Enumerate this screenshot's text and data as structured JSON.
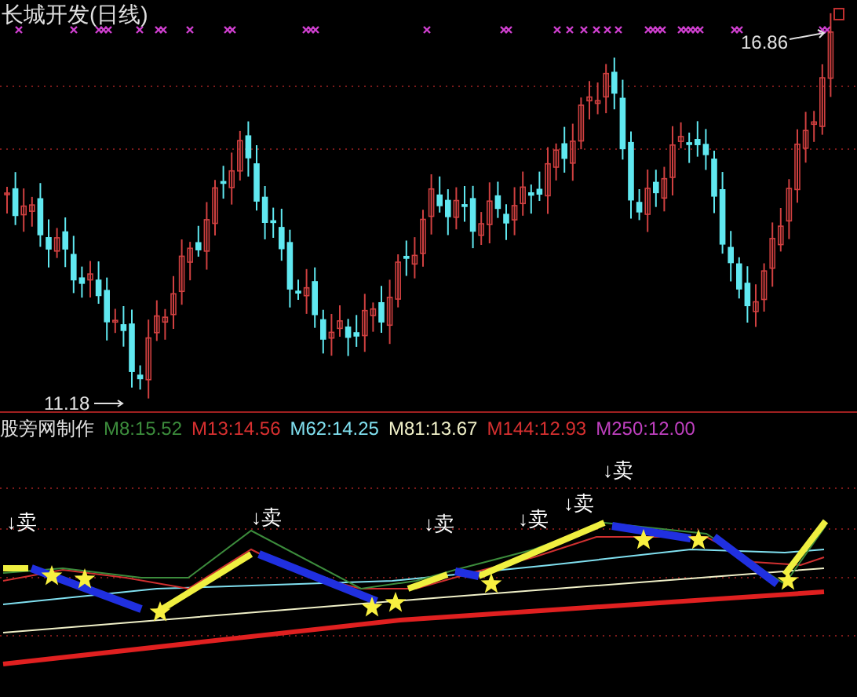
{
  "price_panel": {
    "title": "长城开发(日线)",
    "high_label": "16.86",
    "low_label": "11.18"
  },
  "indicator_panel": {
    "title": "股旁网制作",
    "readouts": [
      {
        "text": "M8:15.52",
        "color": "#3c8c3c"
      },
      {
        "text": "M13:14.56",
        "color": "#d83030"
      },
      {
        "text": "M62:14.25",
        "color": "#80e0f0"
      },
      {
        "text": "M81:13.67",
        "color": "#f0f0c8"
      },
      {
        "text": "M144:12.93",
        "color": "#d83030"
      },
      {
        "text": "M250:12.00",
        "color": "#c040c0"
      }
    ],
    "sell_signals": [
      {
        "text": "↓卖"
      },
      {
        "text": "↓卖"
      },
      {
        "text": "↓卖"
      },
      {
        "text": "↓卖"
      },
      {
        "text": "↓卖"
      },
      {
        "text": "↓卖"
      }
    ]
  }
}
